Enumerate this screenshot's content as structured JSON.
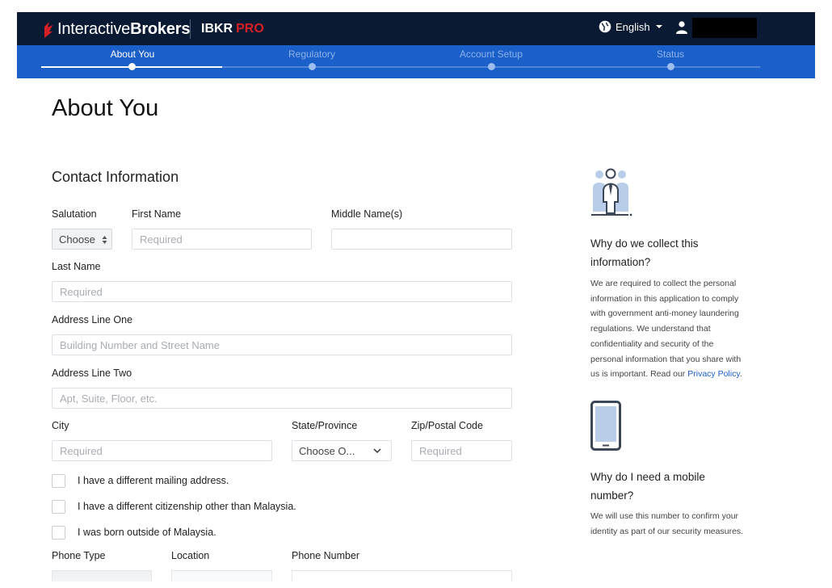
{
  "header": {
    "brand_light": "Interactive",
    "brand_bold": "Brokers",
    "product": "IBKR",
    "product_suffix": "PRO",
    "language": "English"
  },
  "steps": [
    {
      "label": "About You",
      "active": true
    },
    {
      "label": "Regulatory",
      "active": false
    },
    {
      "label": "Account Setup",
      "active": false
    },
    {
      "label": "Status",
      "active": false
    }
  ],
  "page": {
    "title": "About You",
    "section_title": "Contact Information"
  },
  "form": {
    "salutation_label": "Salutation",
    "salutation_value": "Choose",
    "first_name_label": "First Name",
    "first_name_placeholder": "Required",
    "middle_name_label": "Middle Name(s)",
    "middle_name_placeholder": "",
    "last_name_label": "Last Name",
    "last_name_placeholder": "Required",
    "address1_label": "Address Line One",
    "address1_placeholder": "Building Number and Street Name",
    "address2_label": "Address Line Two",
    "address2_placeholder": "Apt, Suite, Floor, etc.",
    "city_label": "City",
    "city_placeholder": "Required",
    "state_label": "State/Province",
    "state_value": "Choose O...",
    "zip_label": "Zip/Postal Code",
    "zip_placeholder": "Required",
    "checkboxes": [
      "I have a different mailing address.",
      "I have a different citizenship other than Malaysia.",
      "I was born outside of Malaysia."
    ],
    "phone_type_label": "Phone Type",
    "location_label": "Location",
    "phone_number_label": "Phone Number"
  },
  "sidebar": {
    "q1_line1": "Why do we collect this",
    "q1_line2": "information?",
    "p1_lines": [
      "We are required to collect the personal",
      "information in this application to comply",
      "with government anti-money laundering",
      "regulations. We understand that",
      "confidentiality and security of the",
      "personal information that you share with"
    ],
    "p1_last_prefix": "us is important. Read our",
    "privacy_link": "Privacy Policy",
    "q2_line1": "Why do I need a mobile",
    "q2_line2": "number?",
    "p2_lines": [
      "We will use this number to confirm your",
      "identity as part of our security measures."
    ]
  },
  "colors": {
    "header_bg": "#0b1a33",
    "steps_bg": "#1b5fc9",
    "brand_red": "#d81f26",
    "link": "#1b5fc9"
  }
}
